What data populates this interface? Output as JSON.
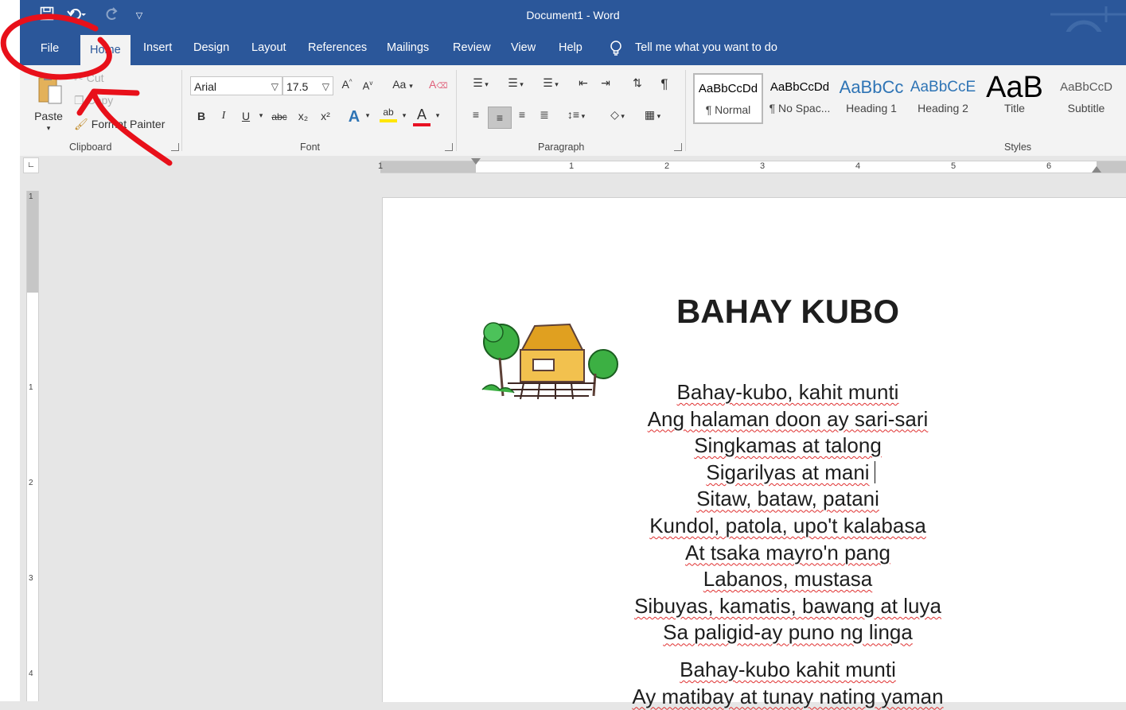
{
  "title_bar": {
    "title": "Document1  -  Word"
  },
  "qat": {
    "save_icon": "save-icon",
    "undo_icon": "undo-icon",
    "redo_icon": "redo-icon",
    "customize_icon": "chevron-down-icon"
  },
  "tabs": [
    {
      "label": "File"
    },
    {
      "label": "Home"
    },
    {
      "label": "Insert"
    },
    {
      "label": "Design"
    },
    {
      "label": "Layout"
    },
    {
      "label": "References"
    },
    {
      "label": "Mailings"
    },
    {
      "label": "Review"
    },
    {
      "label": "View"
    },
    {
      "label": "Help"
    }
  ],
  "tell_me": "Tell me what you want to do",
  "clipboard": {
    "paste": "Paste",
    "cut": "Cut",
    "copy": "Copy",
    "format_painter": "Format Painter",
    "label": "Clipboard"
  },
  "font": {
    "name": "Arial",
    "size": "17.5",
    "label": "Font",
    "change_case": "Aa",
    "bold": "B",
    "italic": "I",
    "underline": "U",
    "strike": "abc",
    "sub": "x₂",
    "sup": "x²"
  },
  "paragraph": {
    "label": "Paragraph",
    "show_marks": "¶"
  },
  "styles": {
    "label": "Styles",
    "items": [
      {
        "preview": "AaBbCcDd",
        "name": "¶ Normal",
        "color": "#000000"
      },
      {
        "preview": "AaBbCcDd",
        "name": "¶ No Spac...",
        "color": "#000000"
      },
      {
        "preview": "AaBbCc",
        "name": "Heading 1",
        "color": "#2e74b5"
      },
      {
        "preview": "AaBbCcE",
        "name": "Heading 2",
        "color": "#2e74b5"
      },
      {
        "preview": "AaB",
        "name": "Title",
        "color": "#000000"
      },
      {
        "preview": "AaBbCcD",
        "name": "Subtitle",
        "color": "#595959"
      }
    ]
  },
  "ruler": {
    "h_numbers": [
      "1",
      "1",
      "2",
      "3",
      "4",
      "5",
      "6"
    ],
    "v_numbers": [
      "1",
      "1",
      "2",
      "3",
      "4"
    ]
  },
  "document": {
    "heading": "BAHAY KUBO",
    "stanza1": [
      "Bahay-kubo, kahit munti",
      "Ang halaman doon ay sari-sari",
      "Singkamas at talong",
      "Sigarilyas at mani",
      "Sitaw, bataw, patani",
      "Kundol, patola, upo't kalabasa",
      "At tsaka mayro'n pang",
      "Labanos, mustasa",
      "Sibuyas, kamatis, bawang at luya",
      "Sa paligid-ay puno ng linga"
    ],
    "stanza2": [
      "Bahay-kubo kahit munti",
      "Ay matibay at tunay nating yaman"
    ]
  },
  "colors": {
    "ribbon_blue": "#2b579a",
    "annotation_red": "#e8101a"
  }
}
